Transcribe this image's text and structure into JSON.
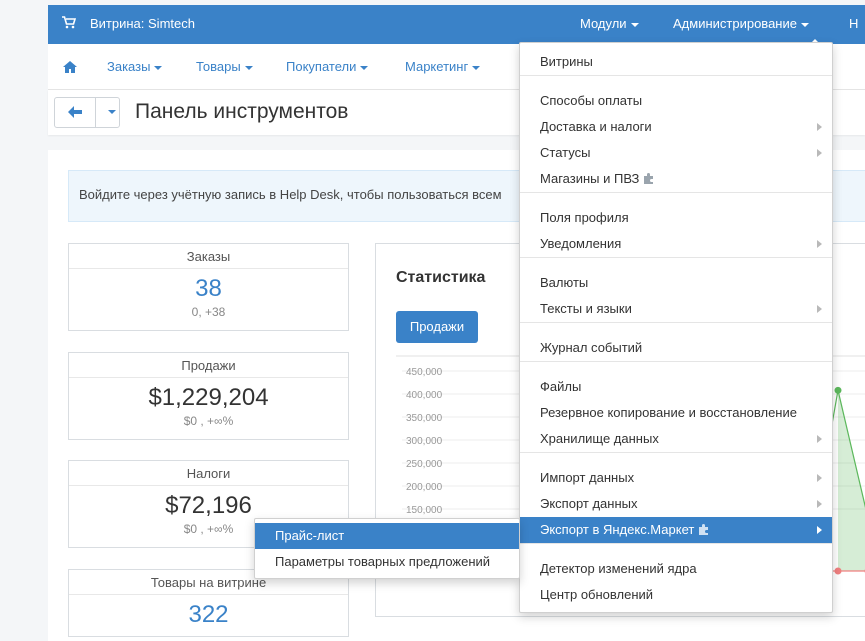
{
  "topbar": {
    "store_label": "Витрина: Simtech",
    "modules_label": "Модули",
    "admin_label": "Администрирование",
    "more_label": "Н"
  },
  "nav": {
    "items": [
      "Заказы",
      "Товары",
      "Покупатели",
      "Маркетинг"
    ]
  },
  "title_bar": {
    "title": "Панель инструментов"
  },
  "alert": {
    "text": "Войдите через учётную запись в Help Desk, чтобы пользоваться всем"
  },
  "stats": [
    {
      "label": "Заказы",
      "value": "38",
      "sub": "0, +38"
    },
    {
      "label": "Продажи",
      "value": "$1,229,204",
      "sub": "$0 , +∞%"
    },
    {
      "label": "Налоги",
      "value": "$72,196",
      "sub": "$0 , +∞%"
    },
    {
      "label": "Товары на витрине",
      "value": "322"
    }
  ],
  "statistics": {
    "title": "Статистика",
    "sales_button": "Продажи"
  },
  "chart_data": {
    "type": "area",
    "y_ticks": [
      "450,000",
      "400,000",
      "350,000",
      "300,000",
      "250,000",
      "200,000",
      "150,000"
    ],
    "ylim": [
      0,
      450000
    ],
    "series": [
      {
        "color": "#5cb85c",
        "points": [
          null,
          408000,
          130000
        ]
      },
      {
        "color": "#f08080",
        "points": [
          0,
          0,
          0
        ]
      }
    ],
    "grid": true
  },
  "admin_menu": {
    "items": [
      {
        "label": "Витрины"
      },
      {
        "label": "Способы оплаты"
      },
      {
        "label": "Доставка и налоги",
        "submenu": true
      },
      {
        "label": "Статусы",
        "submenu": true
      },
      {
        "label": "Магазины и ПВЗ",
        "addon": true
      },
      {
        "label": "Поля профиля"
      },
      {
        "label": "Уведомления",
        "submenu": true
      },
      {
        "label": "Валюты"
      },
      {
        "label": "Тексты и языки",
        "submenu": true
      },
      {
        "label": "Журнал событий"
      },
      {
        "label": "Файлы"
      },
      {
        "label": "Резервное копирование и восстановление"
      },
      {
        "label": "Хранилище данных",
        "submenu": true
      },
      {
        "label": "Импорт данных",
        "submenu": true
      },
      {
        "label": "Экспорт данных",
        "submenu": true
      },
      {
        "label": "Экспорт в Яндекс.Маркет",
        "submenu": true,
        "addon": true,
        "active": true
      },
      {
        "label": "Детектор изменений ядра"
      },
      {
        "label": "Центр обновлений"
      }
    ]
  },
  "yandex_submenu": {
    "items": [
      "Прайс-лист",
      "Параметры товарных предложений"
    ]
  },
  "colors": {
    "primary": "#3a82c8",
    "alert_bg": "#eef6fc",
    "chart_green": "#5cb85c",
    "chart_red": "#f08080"
  }
}
